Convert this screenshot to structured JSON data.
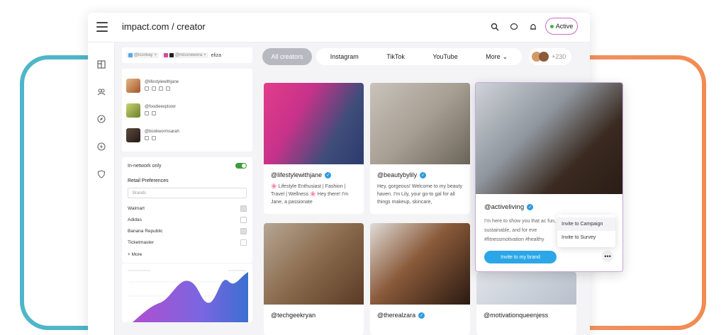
{
  "app": {
    "title": "impact.com / creator",
    "status_label": "Active"
  },
  "topbar": {
    "icons": [
      "search-icon",
      "chat-icon",
      "bell-icon"
    ]
  },
  "rail": {
    "icons": [
      "layout-icon",
      "people-icon",
      "compass-icon",
      "lightning-icon",
      "shield-icon"
    ]
  },
  "search": {
    "chips": [
      {
        "label": "@iconkay"
      },
      {
        "label": "@missnewera"
      }
    ],
    "query": "eliza"
  },
  "creator_list": [
    {
      "handle": "@lifestylewithjane",
      "avatar_color": "#c88a4a"
    },
    {
      "handle": "@foodieexplorer",
      "avatar_color": "#8aa23c"
    },
    {
      "handle": "@bookwormsarah",
      "avatar_color": "#3b2e28"
    }
  ],
  "prefs": {
    "in_network_label": "In-network only",
    "retail_title": "Retail Preferences",
    "brands_placeholder": "Brands",
    "brands": [
      {
        "name": "Walmart",
        "checked": true
      },
      {
        "name": "Adidas",
        "checked": false
      },
      {
        "name": "Banana Republic",
        "checked": true
      },
      {
        "name": "Ticketmaster",
        "checked": false
      }
    ],
    "more_label": "+ More"
  },
  "tabs": [
    {
      "label": "All creators"
    },
    {
      "label": "Instagram"
    },
    {
      "label": "TikTok"
    },
    {
      "label": "YouTube"
    },
    {
      "label": "More"
    }
  ],
  "tab_more_count": "+230",
  "cards": [
    {
      "handle": "@lifestylewithjane",
      "bio": "🌸 Lifestyle Enthusiast | Fashion | Travel | Wellness 🌸 Hey there! I'm Jane, a passionate"
    },
    {
      "handle": "@beautybylily",
      "bio": "Hey, gorgeous! Welcome to my beauty haven. I'm Lily, your go-to gal for all things makeup, skincare,"
    },
    {
      "handle": "@techgeekryan",
      "bio": ""
    },
    {
      "handle": "@therealzara",
      "bio": ""
    },
    {
      "handle": "@motivationqueenjess",
      "bio": ""
    }
  ],
  "expanded": {
    "handle": "@activeliving",
    "bio": "I'm here to show you that ac fun, sustainable, and for eve #fitnessmotivation #healthy",
    "invite_label": "Invite to my brand"
  },
  "dropdown": {
    "items": [
      "Invite to Campaign",
      "Invite to Survey"
    ]
  },
  "colors": {
    "accent": "#2ba7e8",
    "status_border": "#c86cc4",
    "toggle": "#3c9b3c"
  }
}
